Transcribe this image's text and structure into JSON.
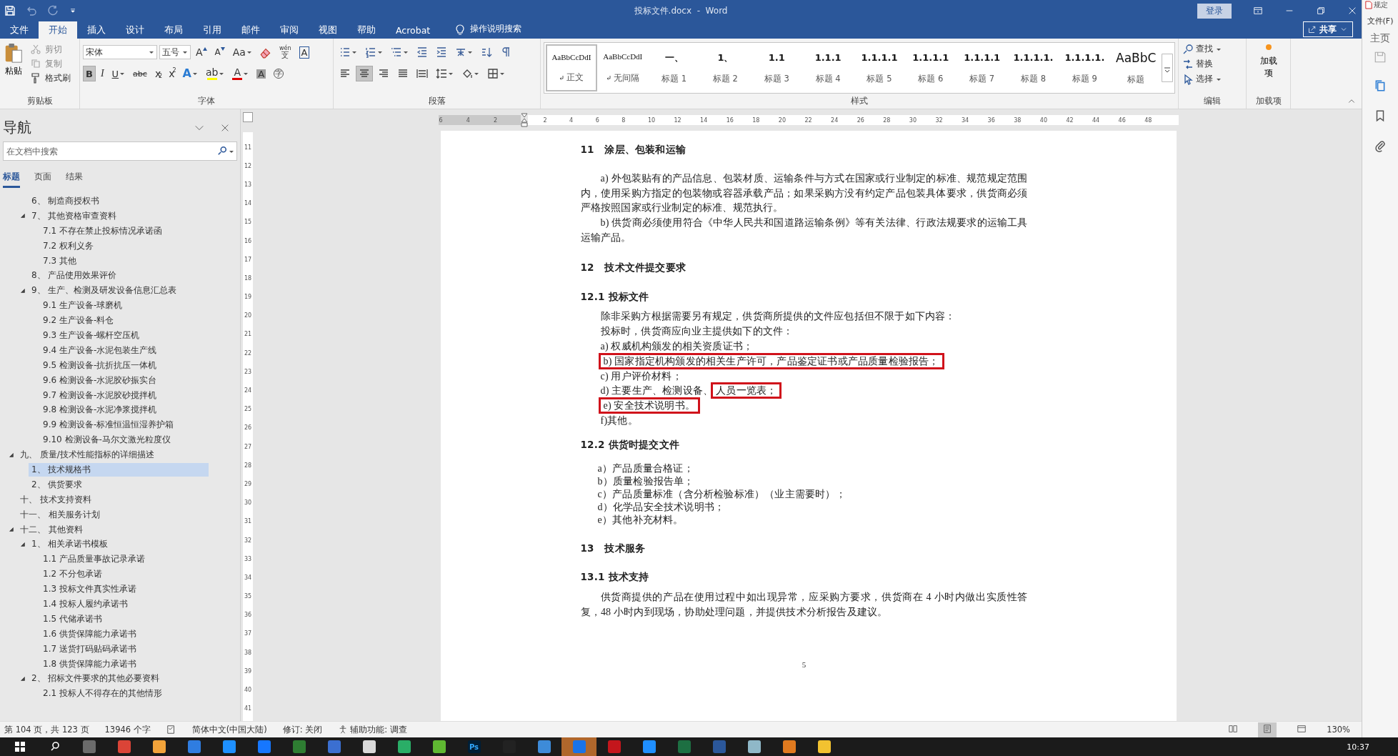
{
  "window": {
    "title": "投标文件.docx  -  Word",
    "login": "登录"
  },
  "other_window": {
    "title": "规定",
    "menu": "文件(F)",
    "tab": "主页"
  },
  "tabs": [
    {
      "label": "文件",
      "selected": false
    },
    {
      "label": "开始",
      "selected": true
    },
    {
      "label": "插入",
      "selected": false
    },
    {
      "label": "设计",
      "selected": false
    },
    {
      "label": "布局",
      "selected": false
    },
    {
      "label": "引用",
      "selected": false
    },
    {
      "label": "邮件",
      "selected": false
    },
    {
      "label": "审阅",
      "selected": false
    },
    {
      "label": "视图",
      "selected": false
    },
    {
      "label": "帮助",
      "selected": false
    },
    {
      "label": "Acrobat",
      "selected": false
    }
  ],
  "tell_me": "操作说明搜索",
  "share": "共享",
  "ribbon": {
    "groups": [
      {
        "kind": "clipboard",
        "label": "剪贴板",
        "paste": "粘贴",
        "items": [
          {
            "kind": "cut",
            "label": "剪切",
            "disabled": true
          },
          {
            "kind": "copy",
            "label": "复制",
            "disabled": true
          },
          {
            "kind": "painter",
            "label": "格式刷",
            "disabled": false
          }
        ]
      },
      {
        "kind": "font",
        "label": "字体",
        "font_name": "宋体",
        "font_size": "五号",
        "row1": [
          {
            "kind": "grow",
            "text": "A"
          },
          {
            "kind": "shrink",
            "text": "A"
          },
          {
            "kind": "case",
            "text": "Aa",
            "dropdown": true
          },
          {
            "kind": "clear"
          },
          {
            "kind": "phonetic",
            "text": "wén",
            "sub": "文"
          },
          {
            "kind": "charborder",
            "text": "A"
          }
        ],
        "row2": [
          {
            "kind": "bold",
            "text": "B",
            "selected": true
          },
          {
            "kind": "italic",
            "text": "I",
            "selected": false
          },
          {
            "kind": "underline",
            "text": "U",
            "selected": false,
            "dropdown": true
          },
          {
            "kind": "strike",
            "text": "abc",
            "selected": false
          },
          {
            "kind": "sub",
            "text": "x",
            "sub": "2",
            "selected": false
          },
          {
            "kind": "sup",
            "text": "x",
            "sub": "2",
            "selected": false
          },
          {
            "kind": "effects",
            "text": "A",
            "dropdown": true
          },
          {
            "kind": "highlight",
            "text": "ab",
            "dropdown": true
          },
          {
            "kind": "fontcolor",
            "text": "A",
            "dropdown": true
          },
          {
            "kind": "shading",
            "text": "A"
          },
          {
            "kind": "enclose",
            "text": "字"
          }
        ]
      },
      {
        "kind": "paragraph",
        "label": "段落",
        "row1": [
          {
            "kind": "bullets",
            "dropdown": true
          },
          {
            "kind": "numbering",
            "dropdown": true
          },
          {
            "kind": "multilevel",
            "dropdown": true
          },
          {
            "kind": "outdent"
          },
          {
            "kind": "indent"
          },
          {
            "kind": "asian",
            "dropdown": true
          },
          {
            "kind": "sort"
          },
          {
            "kind": "marks"
          }
        ],
        "row2": [
          {
            "kind": "alignleft",
            "selected": false
          },
          {
            "kind": "aligncenter",
            "selected": true
          },
          {
            "kind": "alignright",
            "selected": false
          },
          {
            "kind": "justify",
            "selected": false
          },
          {
            "kind": "distributed",
            "selected": false
          },
          {
            "kind": "linespacing",
            "dropdown": true
          },
          {
            "kind": "fill",
            "dropdown": true
          },
          {
            "kind": "borders",
            "dropdown": true
          }
        ]
      },
      {
        "kind": "styles",
        "label": "样式",
        "styles": [
          {
            "preview": "AaBbCcDdI",
            "name": "正文",
            "selected": true,
            "mark": true
          },
          {
            "preview": "AaBbCcDdI",
            "name": "无间隔",
            "selected": false,
            "mark": true
          },
          {
            "preview": "一、",
            "name": "标题 1",
            "selected": false
          },
          {
            "preview": "1、",
            "name": "标题 2",
            "selected": false
          },
          {
            "preview": "1.1",
            "name": "标题 3",
            "selected": false
          },
          {
            "preview": "1.1.1",
            "name": "标题 4",
            "selected": false
          },
          {
            "preview": "1.1.1.1",
            "name": "标题 5",
            "selected": false
          },
          {
            "preview": "1.1.1.1",
            "name": "标题 6",
            "selected": false
          },
          {
            "preview": "1.1.1.1",
            "name": "标题 7",
            "selected": false
          },
          {
            "preview": "1.1.1.1.",
            "name": "标题 8",
            "selected": false
          },
          {
            "preview": "1.1.1.1.",
            "name": "标题 9",
            "selected": false
          },
          {
            "preview": "AaBbC",
            "name": "标题",
            "selected": false
          }
        ]
      },
      {
        "kind": "editing",
        "label": "编辑",
        "items": [
          {
            "kind": "find",
            "label": "查找",
            "dropdown": true
          },
          {
            "kind": "replace",
            "label": "替换"
          },
          {
            "kind": "select",
            "label": "选择",
            "dropdown": true
          }
        ]
      },
      {
        "kind": "addins",
        "label": "加载项",
        "button": "加载项"
      }
    ]
  },
  "nav": {
    "title": "导航",
    "search": {
      "placeholder": "在文档中搜索"
    },
    "tabs": [
      {
        "label": "标题",
        "selected": true
      },
      {
        "label": "页面",
        "selected": false
      },
      {
        "label": "结果",
        "selected": false
      }
    ],
    "tree": [
      {
        "children": [
          {
            "label": "6、 制造商授权书",
            "selected": false
          },
          {
            "label": "7、 其他资格审查资料",
            "selected": false,
            "expanded": true,
            "children": [
              {
                "label": "7.1 不存在禁止投标情况承诺函",
                "selected": false
              },
              {
                "label": "7.2 权利义务",
                "selected": false
              },
              {
                "label": "7.3 其他",
                "selected": false
              }
            ]
          },
          {
            "label": "8、 产品使用效果评价",
            "selected": false
          },
          {
            "label": "9、 生产、检测及研发设备信息汇总表",
            "selected": false,
            "expanded": true,
            "children": [
              {
                "label": "9.1 生产设备-球磨机",
                "selected": false
              },
              {
                "label": "9.2 生产设备-料仓",
                "selected": false
              },
              {
                "label": "9.3 生产设备-螺杆空压机",
                "selected": false
              },
              {
                "label": "9.4 生产设备-水泥包装生产线",
                "selected": false
              },
              {
                "label": "9.5 检测设备-抗折抗压一体机",
                "selected": false
              },
              {
                "label": "9.6 检测设备-水泥胶砂振实台",
                "selected": false
              },
              {
                "label": "9.7 检测设备-水泥胶砂搅拌机",
                "selected": false
              },
              {
                "label": "9.8 检测设备-水泥净浆搅拌机",
                "selected": false
              },
              {
                "label": "9.9 检测设备-标准恒温恒湿养护箱",
                "selected": false
              },
              {
                "label": "9.10 检测设备-马尔文激光粒度仪",
                "selected": false
              }
            ]
          }
        ]
      },
      {
        "label": "九、 质量/技术性能指标的详细描述",
        "selected": false,
        "expanded": true,
        "children": [
          {
            "label": "1、 技术规格书",
            "selected": true
          },
          {
            "label": "2、 供货要求",
            "selected": false
          }
        ]
      },
      {
        "label": "十、 技术支持资料",
        "selected": false
      },
      {
        "label": "十一、 相关服务计划",
        "selected": false
      },
      {
        "label": "十二、 其他资料",
        "selected": false,
        "expanded": true,
        "children": [
          {
            "label": "1、 相关承诺书模板",
            "selected": false,
            "expanded": true,
            "children": [
              {
                "label": "1.1 产品质量事故记录承诺",
                "selected": false
              },
              {
                "label": "1.2 不分包承诺",
                "selected": false
              },
              {
                "label": "1.3 投标文件真实性承诺",
                "selected": false
              },
              {
                "label": "1.4 投标人履约承诺书",
                "selected": false
              },
              {
                "label": "1.5 代储承诺书",
                "selected": false
              },
              {
                "label": "1.6 供货保障能力承诺书",
                "selected": false
              },
              {
                "label": "1.7 送货打码贴码承诺书",
                "selected": false
              },
              {
                "label": "1.8 供货保障能力承诺书",
                "selected": false
              }
            ]
          },
          {
            "label": "2、 招标文件要求的其他必要资料",
            "selected": false,
            "expanded": true,
            "children": [
              {
                "label": "2.1 投标人不得存在的其他情形",
                "selected": false
              }
            ]
          }
        ]
      }
    ]
  },
  "ruler": {
    "left_labels": [
      "6",
      "4",
      "2"
    ],
    "right_labels": [
      "2",
      "4",
      "6",
      "8",
      "10",
      "12",
      "14",
      "16",
      "18",
      "20",
      "22",
      "24",
      "26",
      "28",
      "30",
      "32",
      "34",
      "36",
      "38",
      "40",
      "42",
      "44",
      "46",
      "48"
    ],
    "vertical_labels": [
      "11",
      "12",
      "13",
      "14",
      "15",
      "16",
      "17",
      "18",
      "19",
      "20",
      "21",
      "22",
      "23",
      "24",
      "25",
      "26",
      "27",
      "28",
      "29",
      "30",
      "31",
      "32",
      "33",
      "34",
      "35",
      "36",
      "37",
      "38",
      "39",
      "40",
      "41"
    ]
  },
  "document": {
    "blocks": [
      {
        "kind": "h1",
        "spans": [
          {
            "text": "11   涂层、包装和运输"
          }
        ]
      },
      {
        "kind": "para",
        "spans": [
          {
            "text": "a) 外包装贴有的产品信息、包装材质、运输条件与方式在国家或行业制定的标准、规范规定范围内，使用采购方指定的包装物或容器承载产品；如果采购方没有约定产品包装具体要求，供货商必须严格按照国家或行业制定的标准、规范执行。"
          }
        ]
      },
      {
        "kind": "para",
        "spans": [
          {
            "text": "b) 供货商必须使用符合《中华人民共和国道路运输条例》等有关法律、行政法规要求的运输工具运输产品。"
          }
        ]
      },
      {
        "kind": "h1",
        "spans": [
          {
            "text": "12   技术文件提交要求"
          }
        ]
      },
      {
        "kind": "h2",
        "spans": [
          {
            "text": "12.1 投标文件"
          }
        ]
      },
      {
        "kind": "line",
        "spans": [
          {
            "text": "除非采购方根据需要另有规定，供货商所提供的文件应包括但不限于如下内容："
          }
        ]
      },
      {
        "kind": "line",
        "spans": [
          {
            "text": "投标时，供货商应向业主提供如下的文件："
          }
        ]
      },
      {
        "kind": "line",
        "spans": [
          {
            "text": "a) 权威机构颁发的相关资质证书；"
          }
        ]
      },
      {
        "kind": "line",
        "spans": [
          {
            "text": "b) 国家指定机构颁发的相关生产许可，产品鉴定证书或产品质量检验报告；",
            "boxed": true
          }
        ]
      },
      {
        "kind": "line",
        "spans": [
          {
            "text": "c) 用户评价材料；"
          }
        ]
      },
      {
        "kind": "line",
        "spans": [
          {
            "text": "d) 主要生产、检测设备、"
          },
          {
            "text": "人员一览表；",
            "boxed": true
          }
        ]
      },
      {
        "kind": "line",
        "spans": [
          {
            "text": "e) 安全技术说明书。",
            "boxed": true
          }
        ]
      },
      {
        "kind": "line",
        "spans": [
          {
            "text": "f)其他。"
          }
        ]
      },
      {
        "kind": "h2",
        "spans": [
          {
            "text": "12.2 供货时提交文件"
          }
        ]
      },
      {
        "kind": "item",
        "spans": [
          {
            "text": "a）产品质量合格证；"
          }
        ]
      },
      {
        "kind": "item",
        "spans": [
          {
            "text": "b）质量检验报告单；"
          }
        ]
      },
      {
        "kind": "item",
        "spans": [
          {
            "text": "c）产品质量标准（含分析检验标准）（业主需要时）；"
          }
        ]
      },
      {
        "kind": "item",
        "spans": [
          {
            "text": "d）化学品安全技术说明书；"
          }
        ]
      },
      {
        "kind": "item",
        "spans": [
          {
            "text": "e）其他补充材料。"
          }
        ]
      },
      {
        "kind": "h1",
        "spans": [
          {
            "text": "13   技术服务"
          }
        ]
      },
      {
        "kind": "h2",
        "spans": [
          {
            "text": "13.1 技术支持"
          }
        ]
      },
      {
        "kind": "para",
        "spans": [
          {
            "text": "供货商提供的产品在使用过程中如出现异常，应采购方要求，供货商在 4 小时内做出实质性答复，48 小时内到现场，协助处理问题，并提供技术分析报告及建议。"
          }
        ]
      }
    ],
    "page_number": "5"
  },
  "status_bar": {
    "items": [
      {
        "kind": "plain",
        "text": "第 104 页，共 123 页"
      },
      {
        "kind": "plain",
        "text": "13946 个字"
      },
      {
        "kind": "proofing"
      },
      {
        "kind": "plain",
        "text": "简体中文(中国大陆)"
      },
      {
        "kind": "plain",
        "text": "修订: 关闭"
      },
      {
        "kind": "accessibility",
        "text": "辅助功能: 调查"
      }
    ],
    "views": [
      {
        "kind": "read",
        "selected": false
      },
      {
        "kind": "print",
        "selected": true
      },
      {
        "kind": "web",
        "selected": false
      }
    ],
    "zoom": "130%"
  },
  "taskbar": {
    "apps": [
      {
        "color": "#6b6b6b",
        "selected": false
      },
      {
        "color": "#db4437",
        "selected": false
      },
      {
        "color": "#f2a33a",
        "selected": false
      },
      {
        "color": "#2f7de1",
        "selected": false
      },
      {
        "color": "#1e90ff",
        "selected": false
      },
      {
        "color": "#1677ff",
        "selected": false
      },
      {
        "color": "#2e7d32",
        "selected": false
      },
      {
        "color": "#3b6fd1",
        "selected": false
      },
      {
        "color": "#d9d9d9",
        "selected": false
      },
      {
        "color": "#2aae67",
        "selected": false
      },
      {
        "color": "#5fb832",
        "selected": false
      },
      {
        "color": "#001e36",
        "text": "Ps",
        "selected": false
      },
      {
        "color": "#222222",
        "selected": false
      },
      {
        "color": "#3d8bd9",
        "selected": false
      },
      {
        "color": "#1a73e8",
        "selected": true
      },
      {
        "color": "#c4161c",
        "selected": false
      },
      {
        "color": "#1f8fff",
        "selected": false
      },
      {
        "color": "#1d6f42",
        "selected": false
      },
      {
        "color": "#2b579a",
        "selected": false
      },
      {
        "color": "#8fb8c8",
        "selected": false
      },
      {
        "color": "#e07a1f",
        "selected": false
      },
      {
        "color": "#f2c230",
        "selected": false
      }
    ],
    "clock": "10:37"
  }
}
